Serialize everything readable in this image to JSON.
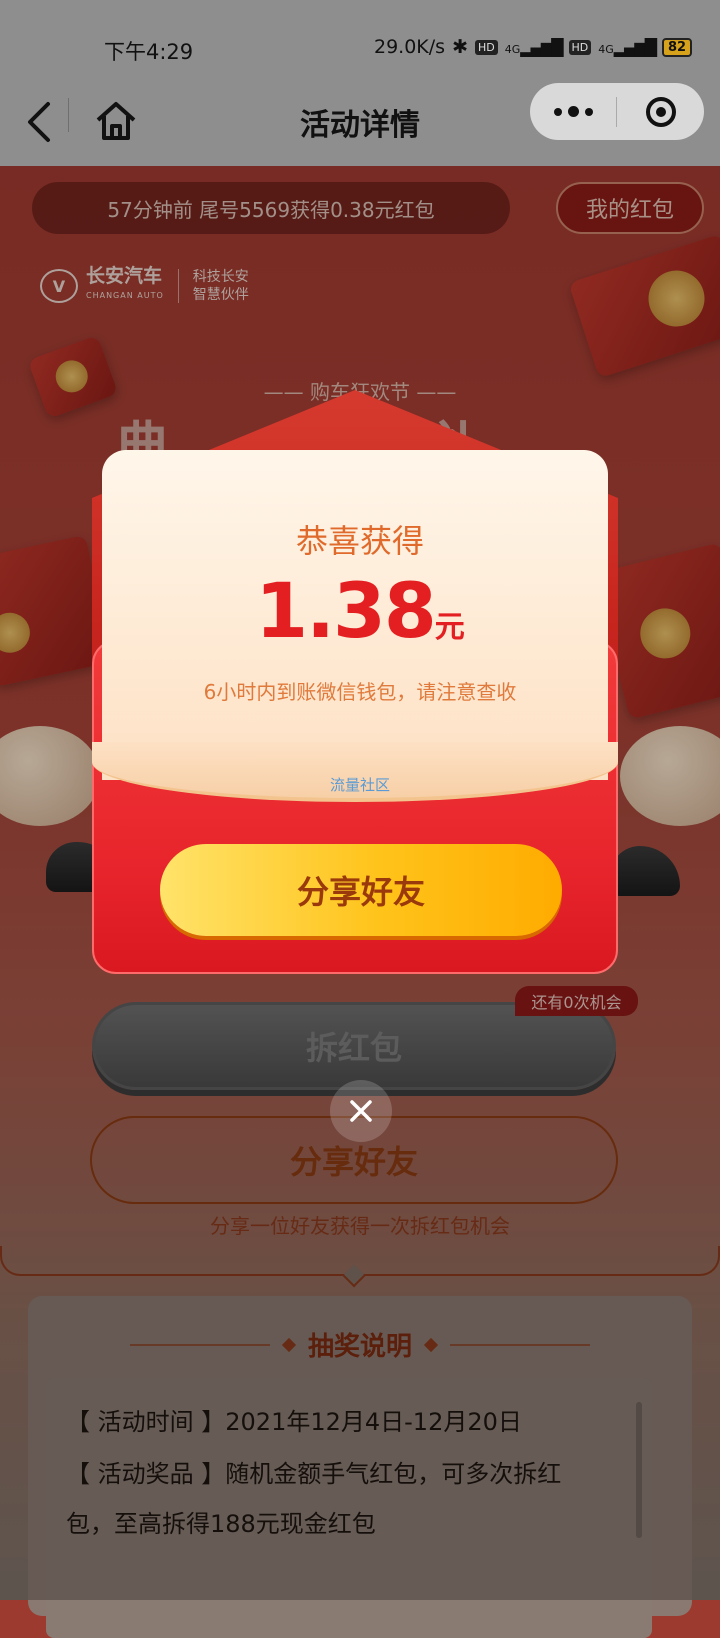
{
  "status_bar": {
    "time": "下午4:29",
    "net_speed": "29.0K/s",
    "hd1": "HD",
    "net1": "4G",
    "hd2": "HD",
    "net2": "4G",
    "battery": "82",
    "icons": [
      "bluetooth-icon",
      "signal-icon",
      "signal-icon",
      "battery-icon"
    ]
  },
  "nav": {
    "title": "活动详情",
    "icons": [
      "back-icon",
      "home-icon",
      "more-icon",
      "close-miniprogram-icon"
    ]
  },
  "page": {
    "ticker": "57分钟前 尾号5569获得0.38元红包",
    "my_redpacket": "我的红包",
    "brand": {
      "name": "长安汽车",
      "name_en": "CHANGAN AUTO",
      "slogan_1": "科技长安",
      "slogan_2": "智慧伙伴"
    },
    "subtitle": "—— 购车狂欢节 ——",
    "title_visible": "典 礼",
    "open_button": "拆红包",
    "chances_badge": "还有0次机会",
    "share_button": "分享好友",
    "share_hint": "分享一位好友获得一次拆红包机会",
    "rules": {
      "title": "抽奖说明",
      "lines": [
        "【 活动时间 】2021年12月4日-12月20日",
        "【 活动奖品 】随机金额手气红包，可多次拆红",
        "包，至高拆得188元现金红包"
      ]
    }
  },
  "modal": {
    "congrats": "恭喜获得",
    "amount": "1.38",
    "unit": "元",
    "notice": "6小时内到账微信钱包，请注意查收",
    "watermark": "流量社区",
    "share_button": "分享好友",
    "close_icon": "close-icon"
  },
  "colors": {
    "accent_red": "#e41f22",
    "gold": "#ffc31a",
    "brown_text": "#8a3a12"
  }
}
